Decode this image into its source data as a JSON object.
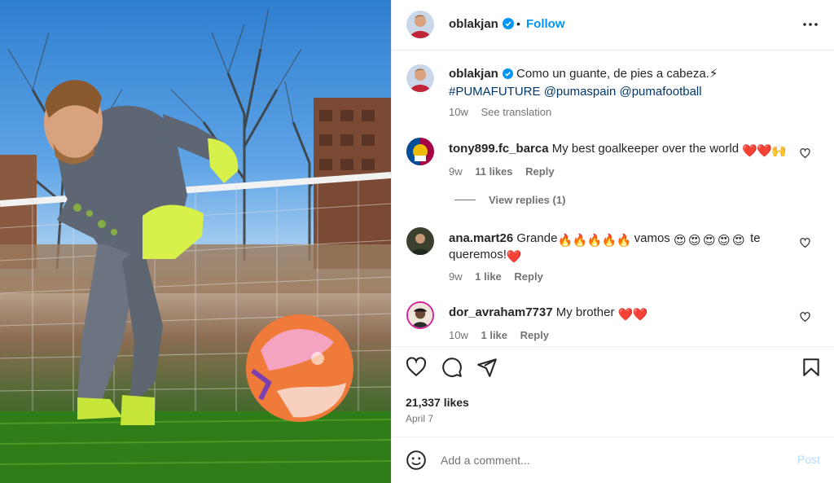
{
  "post": {
    "username": "oblakjan",
    "follow_label": "Follow",
    "separator": "•",
    "caption": {
      "text": "Como un guante, de pies a cabeza.⚡",
      "tags": [
        "#PUMAFUTURE",
        "@pumaspain",
        "@pumafootball"
      ],
      "time": "10w",
      "see_translation": "See translation"
    },
    "icons": {
      "verified": "verified-badge-icon",
      "more": "more-options-icon",
      "like": "heart-icon",
      "comment": "comment-icon",
      "share": "paper-plane-icon",
      "save": "bookmark-icon",
      "emoji": "smiley-icon"
    }
  },
  "comments": [
    {
      "username": "tony899.fc_barca",
      "text": "My best goalkeeper over the world",
      "emojis": [
        "❤️",
        "❤️",
        "🙌"
      ],
      "time": "9w",
      "likes": "11 likes",
      "reply": "Reply",
      "view_replies": "View replies (1)"
    },
    {
      "username": "ana.mart26",
      "text_before": "Grande",
      "emojis_a": [
        "🔥",
        "🔥",
        "🔥",
        "🔥",
        "🔥"
      ],
      "text_mid": " vamos ",
      "emojis_b": [
        "😍",
        "😍",
        "😍",
        "😍",
        "😍"
      ],
      "text_after": " te queremos!",
      "emojis_c": [
        "❤️"
      ],
      "time": "9w",
      "likes": "1 like",
      "reply": "Reply"
    },
    {
      "username": "dor_avraham7737",
      "text": "My brother",
      "emojis": [
        "❤️",
        "❤️"
      ],
      "time": "10w",
      "likes": "1 like",
      "reply": "Reply"
    }
  ],
  "stats": {
    "likes": "21,337 likes",
    "date": "April 7"
  },
  "add_comment": {
    "placeholder": "Add a comment...",
    "post_label": "Post"
  },
  "colors": {
    "accent": "#0095f6",
    "link": "#00376b",
    "muted": "#737373",
    "text": "#262626",
    "divider": "#efefef",
    "post_disabled": "#b3dbff"
  }
}
